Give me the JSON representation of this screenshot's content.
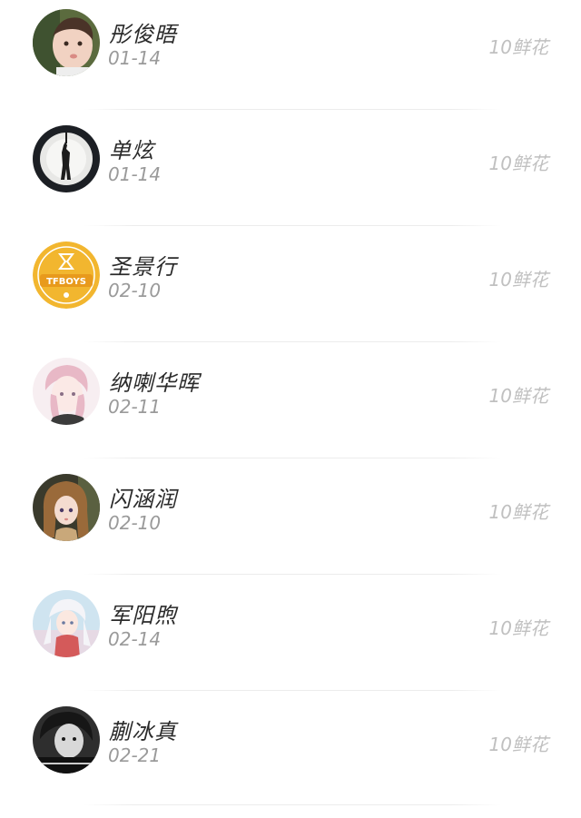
{
  "records": [
    {
      "name": "彤俊晤",
      "date": "01-14",
      "gift": "10鲜花",
      "avatar": "child-portrait"
    },
    {
      "name": "单炫",
      "date": "01-14",
      "gift": "10鲜花",
      "avatar": "spotlight-silhouette"
    },
    {
      "name": "圣景行",
      "date": "02-10",
      "gift": "10鲜花",
      "avatar": "tfboys-logo"
    },
    {
      "name": "纳喇华晖",
      "date": "02-11",
      "gift": "10鲜花",
      "avatar": "anime-pink-hair"
    },
    {
      "name": "闪涵润",
      "date": "02-10",
      "gift": "10鲜花",
      "avatar": "doll-portrait"
    },
    {
      "name": "军阳煦",
      "date": "02-14",
      "gift": "10鲜花",
      "avatar": "anime-white-hair"
    },
    {
      "name": "蒯冰真",
      "date": "02-21",
      "gift": "10鲜花",
      "avatar": "bw-portrait"
    }
  ],
  "colors": {
    "name": "#2a2a2a",
    "date": "#9a9a9a",
    "gift": "#c0c0c0",
    "divider": "#ececec",
    "logo_yellow": "#f2b62f"
  }
}
